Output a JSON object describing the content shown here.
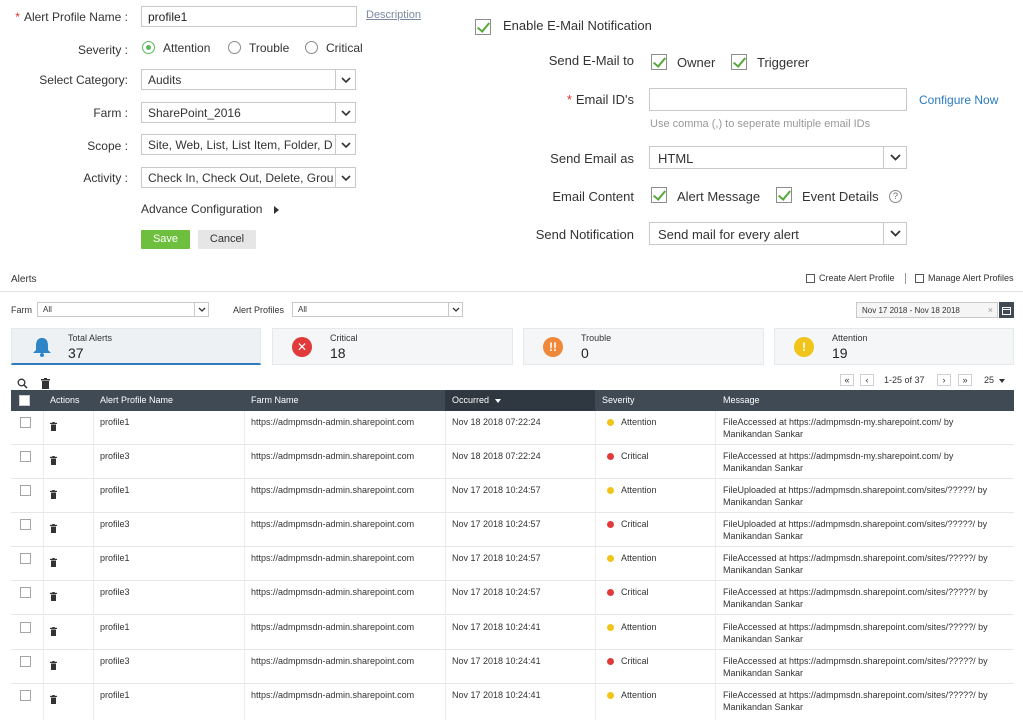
{
  "form": {
    "profile_name_label": "Alert Profile Name :",
    "profile_name_value": "profile1",
    "description_link": "Description",
    "severity_label": "Severity :",
    "severity_options": [
      "Attention",
      "Trouble",
      "Critical"
    ],
    "severity_selected": "Attention",
    "category_label": "Select Category:",
    "category_value": "Audits",
    "farm_label": "Farm :",
    "farm_value": "SharePoint_2016",
    "scope_label": "Scope :",
    "scope_value": "Site, Web, List, List Item, Folder, Doc",
    "activity_label": "Activity :",
    "activity_value": "Check In, Check Out, Delete, Group C",
    "advance_config": "Advance Configuration",
    "save": "Save",
    "cancel": "Cancel"
  },
  "email": {
    "enable_label": "Enable E-Mail Notification",
    "enable_checked": true,
    "send_to_label": "Send E-Mail to",
    "owner_label": "Owner",
    "triggerer_label": "Triggerer",
    "email_ids_label": "Email ID's",
    "email_ids_value": "",
    "configure_now": "Configure Now",
    "email_hint": "Use comma (,) to seperate multiple email IDs",
    "send_as_label": "Send Email as",
    "send_as_value": "HTML",
    "content_label": "Email Content",
    "alert_message_label": "Alert Message",
    "event_details_label": "Event Details",
    "notification_label": "Send Notification",
    "notification_value": "Send mail for every alert"
  },
  "alerts": {
    "title": "Alerts",
    "create_profile": "Create Alert Profile",
    "manage_profiles": "Manage Alert Profiles",
    "farm_filter_label": "Farm",
    "farm_filter_value": "All",
    "profiles_filter_label": "Alert Profiles",
    "profiles_filter_value": "All",
    "date_range": "Nov 17 2018 - Nov 18 2018",
    "cards": [
      {
        "label": "Total Alerts",
        "value": "37"
      },
      {
        "label": "Critical",
        "value": "18"
      },
      {
        "label": "Trouble",
        "value": "0"
      },
      {
        "label": "Attention",
        "value": "19"
      }
    ],
    "pagination": "1-25 of 37",
    "page_size": "25",
    "columns": [
      "Actions",
      "Alert Profile Name",
      "Farm Name",
      "Occurred",
      "Severity",
      "Message"
    ],
    "rows": [
      {
        "profile": "profile1",
        "farm": "https://admpmsdn-admin.sharepoint.com",
        "occurred": "Nov 18 2018 07:22:24",
        "severity": "Attention",
        "msg1": "FileAccessed at https://admpmsdn-my.sharepoint.com/ by",
        "msg2": "Manikandan Sankar"
      },
      {
        "profile": "profile3",
        "farm": "https://admpmsdn-admin.sharepoint.com",
        "occurred": "Nov 18 2018 07:22:24",
        "severity": "Critical",
        "msg1": "FileAccessed at https://admpmsdn-my.sharepoint.com/ by",
        "msg2": "Manikandan Sankar"
      },
      {
        "profile": "profile1",
        "farm": "https://admpmsdn-admin.sharepoint.com",
        "occurred": "Nov 17 2018 10:24:57",
        "severity": "Attention",
        "msg1": "FileUploaded at https://admpmsdn.sharepoint.com/sites/?????/ by",
        "msg2": "Manikandan Sankar"
      },
      {
        "profile": "profile3",
        "farm": "https://admpmsdn-admin.sharepoint.com",
        "occurred": "Nov 17 2018 10:24:57",
        "severity": "Critical",
        "msg1": "FileUploaded at https://admpmsdn.sharepoint.com/sites/?????/ by",
        "msg2": "Manikandan Sankar"
      },
      {
        "profile": "profile1",
        "farm": "https://admpmsdn-admin.sharepoint.com",
        "occurred": "Nov 17 2018 10:24:57",
        "severity": "Attention",
        "msg1": "FileAccessed at https://admpmsdn.sharepoint.com/sites/?????/ by",
        "msg2": "Manikandan Sankar"
      },
      {
        "profile": "profile3",
        "farm": "https://admpmsdn-admin.sharepoint.com",
        "occurred": "Nov 17 2018 10:24:57",
        "severity": "Critical",
        "msg1": "FileAccessed at https://admpmsdn.sharepoint.com/sites/?????/ by",
        "msg2": "Manikandan Sankar"
      },
      {
        "profile": "profile1",
        "farm": "https://admpmsdn-admin.sharepoint.com",
        "occurred": "Nov 17 2018 10:24:41",
        "severity": "Attention",
        "msg1": "FileAccessed at https://admpmsdn.sharepoint.com/sites/?????/ by",
        "msg2": "Manikandan Sankar"
      },
      {
        "profile": "profile3",
        "farm": "https://admpmsdn-admin.sharepoint.com",
        "occurred": "Nov 17 2018 10:24:41",
        "severity": "Critical",
        "msg1": "FileAccessed at https://admpmsdn.sharepoint.com/sites/?????/ by",
        "msg2": "Manikandan Sankar"
      },
      {
        "profile": "profile1",
        "farm": "https://admpmsdn-admin.sharepoint.com",
        "occurred": "Nov 17 2018 10:24:41",
        "severity": "Attention",
        "msg1": "FileAccessed at https://admpmsdn.sharepoint.com/sites/?????/ by",
        "msg2": "Manikandan Sankar"
      }
    ]
  },
  "colors": {
    "save": "#6fbf3f",
    "attention": "#f0c419",
    "critical": "#e03a3a",
    "trouble": "#f0883a",
    "bell": "#2e86c8",
    "header_bg": "#3f4a55",
    "link": "#2a7ac0"
  },
  "icons": [
    "bell-icon",
    "critical-x-icon",
    "trouble-icon",
    "attention-icon",
    "search-icon",
    "trash-icon",
    "calendar-icon",
    "help-icon",
    "sort-desc-icon"
  ]
}
